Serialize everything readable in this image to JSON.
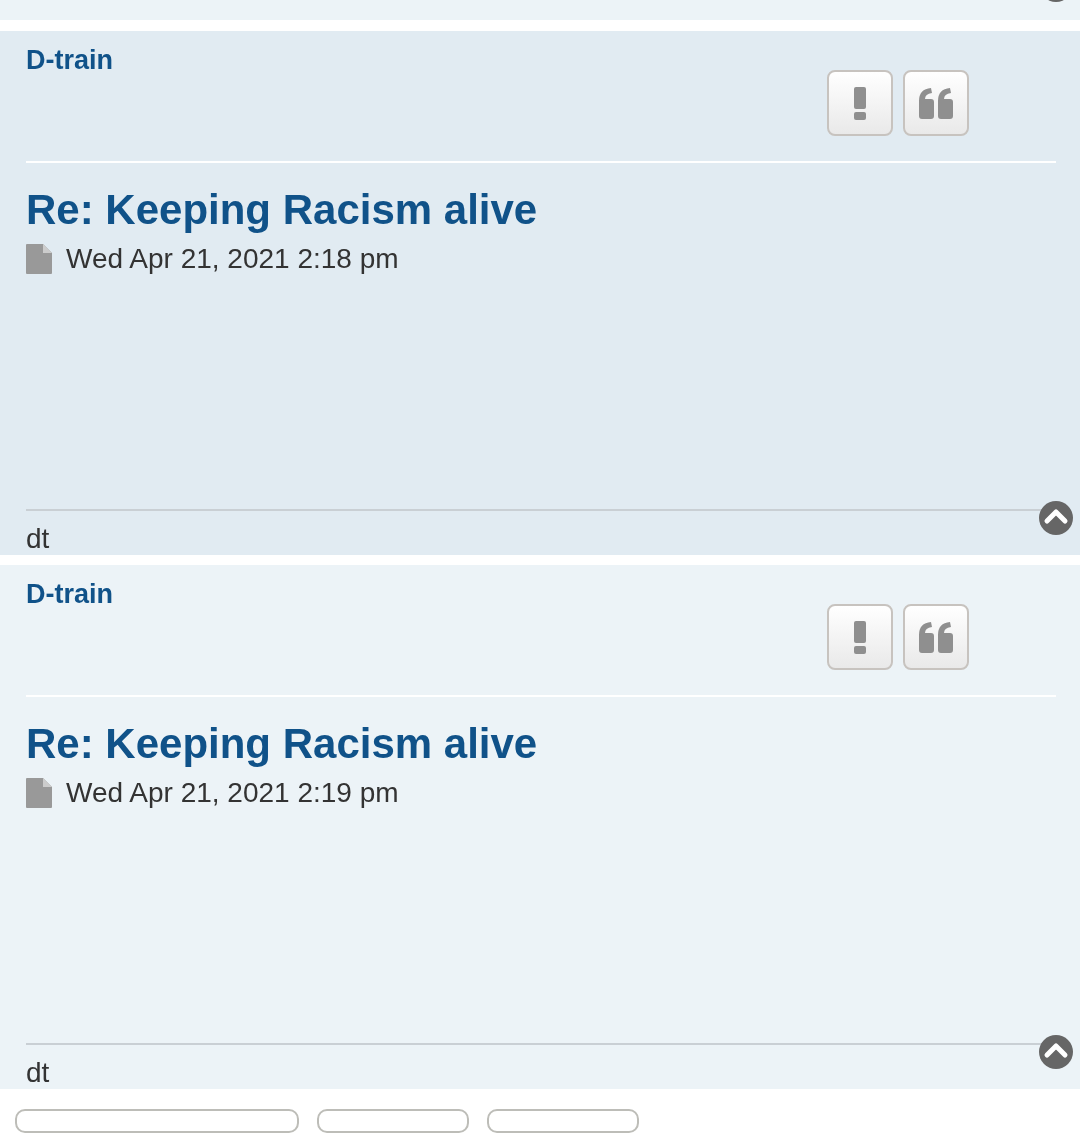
{
  "posts": [
    {
      "kind": "bg2",
      "author": "D-train",
      "title": "Re: Keeping Racism alive",
      "date": "Wed Apr 21, 2021 2:18 pm",
      "signature": "dt"
    },
    {
      "kind": "bg1",
      "author": "D-train",
      "title": "Re: Keeping Racism alive",
      "date": "Wed Apr 21, 2021 2:19 pm",
      "signature": "dt"
    }
  ]
}
